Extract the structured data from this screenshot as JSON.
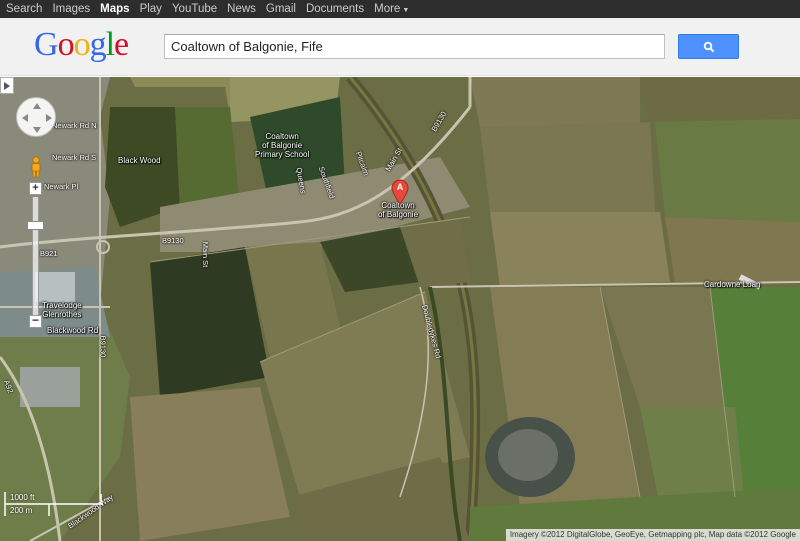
{
  "topbar": {
    "links": [
      "Search",
      "Images",
      "Maps",
      "Play",
      "YouTube",
      "News",
      "Gmail",
      "Documents",
      "More"
    ],
    "active": "Maps"
  },
  "logo": {
    "letters": [
      "G",
      "o",
      "o",
      "g",
      "l",
      "e"
    ],
    "colors": [
      "#3369e8",
      "#d50f25",
      "#eeb211",
      "#3369e8",
      "#009925",
      "#d50f25"
    ]
  },
  "search": {
    "value": "Coaltown of Balgonie, Fife"
  },
  "map": {
    "labels": {
      "school": "Coaltown\nof Balgonie\nPrimary School",
      "black_wood": "Black Wood",
      "coaltown": "Coaltown\nof Balgonie",
      "travelodge": "Travelodge\nGlenrothes",
      "cardowne": "Cardowne Loan",
      "blackwood_rd": "Blackwood Rd",
      "newark_rd_n": "Newark Rd N",
      "newark_rd_s": "Newark Rd S",
      "newark_pl": "Newark Pl",
      "b9130_top": "B9130",
      "b9130_mid": "B9130",
      "b9130_left": "B9130",
      "b921": "B921",
      "main_st": "Main St",
      "main_st2": "Main St",
      "doubledykes": "Doubledykes Rd",
      "blackwood_way": "Blackwood Way",
      "a92": "A92",
      "southfield": "Southfield",
      "queens": "Queens",
      "pitcairn": "Pitcairn"
    },
    "marker_letter": "A",
    "scale": {
      "imperial": "1000 ft",
      "metric": "200 m"
    },
    "copyright": "Imagery ©2012 DigitalGlobe, GeoEye, Getmapping plc, Map data ©2012 Google"
  }
}
